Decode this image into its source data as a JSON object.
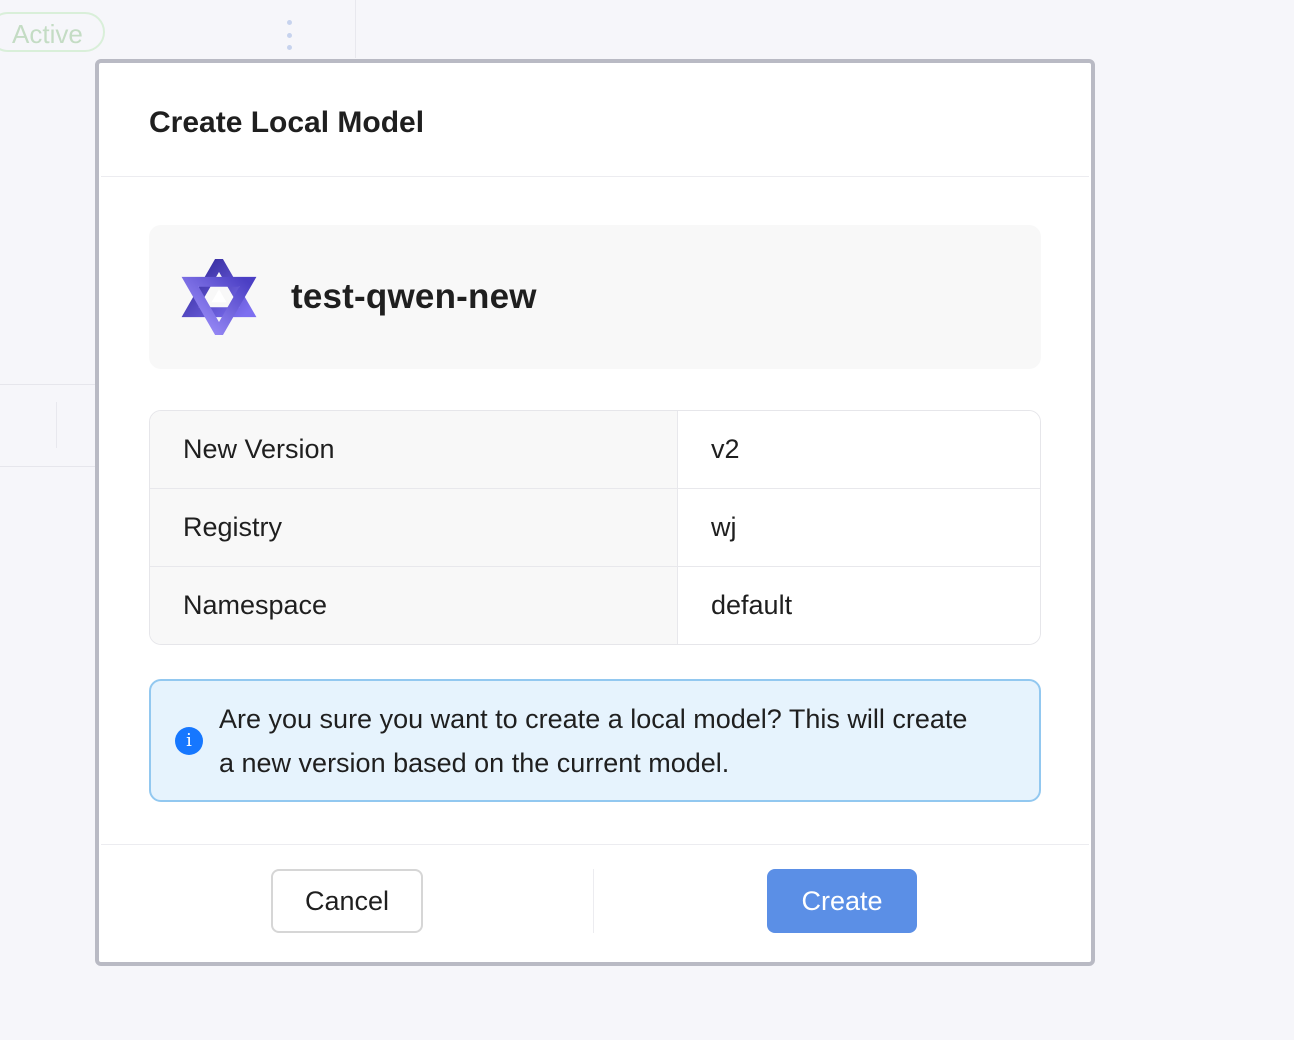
{
  "background": {
    "status_badge": "Active",
    "more_icon": "more-vertical-icon"
  },
  "modal": {
    "title": "Create Local Model",
    "model": {
      "name": "test-qwen-new",
      "logo_icon": "qwen-logo-icon"
    },
    "details": [
      {
        "label": "New Version",
        "value": "v2"
      },
      {
        "label": "Registry",
        "value": "wj"
      },
      {
        "label": "Namespace",
        "value": "default"
      }
    ],
    "alert": {
      "icon": "info-icon",
      "icon_glyph": "i",
      "message": "Are you sure you want to create a local model? This will create a new version based on the current model."
    },
    "footer": {
      "cancel_label": "Cancel",
      "create_label": "Create"
    }
  },
  "colors": {
    "primary_button": "#5b8fe6",
    "info_background": "#e6f3fd",
    "info_border": "#92c8f0",
    "info_icon": "#1677ff",
    "logo_gradient_start": "#3b2fa8",
    "logo_gradient_end": "#8a7cf0"
  }
}
